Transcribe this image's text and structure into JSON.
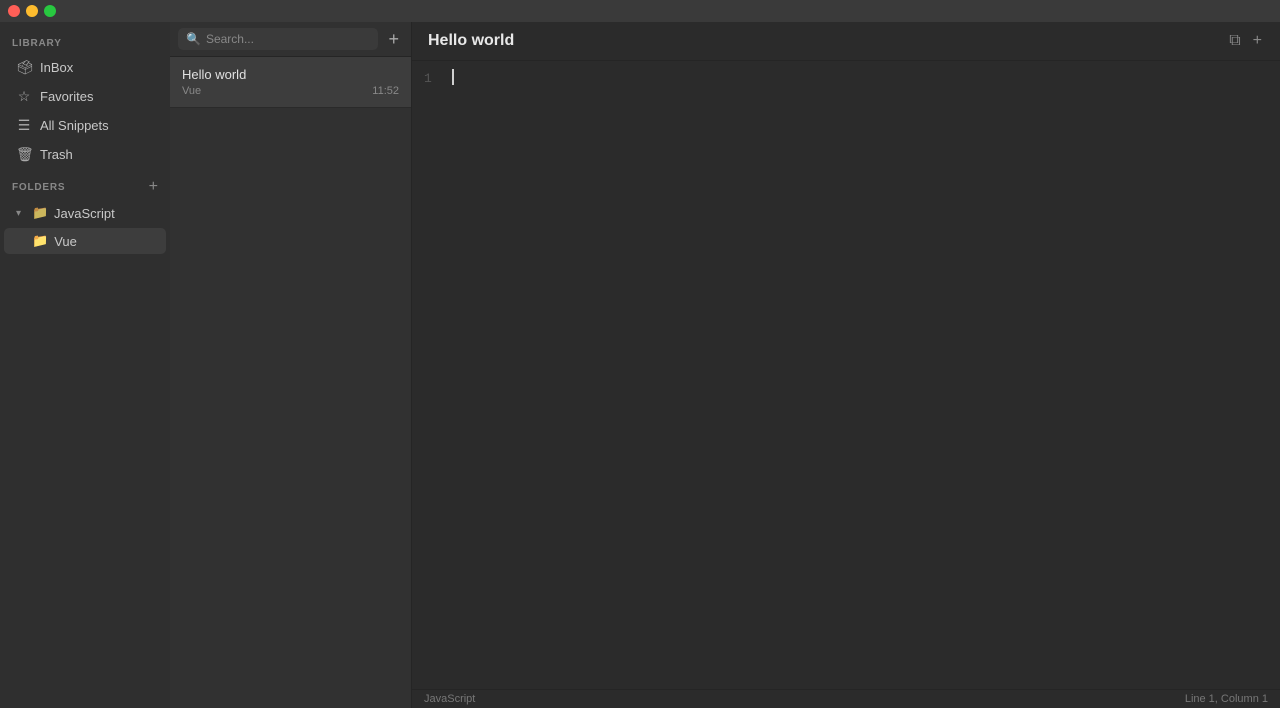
{
  "titlebar": {
    "lights": [
      "close",
      "minimize",
      "maximize"
    ]
  },
  "sidebar": {
    "library_label": "LIBRARY",
    "items": [
      {
        "id": "inbox",
        "label": "InBox",
        "icon": "🗳"
      },
      {
        "id": "favorites",
        "label": "Favorites",
        "icon": "☆"
      },
      {
        "id": "all-snippets",
        "label": "All Snippets",
        "icon": "☰"
      },
      {
        "id": "trash",
        "label": "Trash",
        "icon": "🗑"
      }
    ],
    "folders_label": "FOLDERS",
    "add_folder_label": "+",
    "folders": [
      {
        "id": "javascript",
        "label": "JavaScript",
        "expanded": true,
        "subfolders": [
          {
            "id": "vue",
            "label": "Vue",
            "active": true
          }
        ]
      }
    ]
  },
  "snippet_list": {
    "search_placeholder": "Search...",
    "add_label": "+",
    "snippets": [
      {
        "id": "hello-world",
        "title": "Hello world",
        "folder": "Vue",
        "time": "11:52",
        "active": true
      }
    ]
  },
  "editor": {
    "title": "Hello world",
    "toolbar": {
      "copy_icon": "⧉",
      "plus_icon": "+"
    },
    "line_numbers": [
      "1"
    ],
    "content": "",
    "footer": {
      "language": "JavaScript",
      "position": "Line 1, Column 1"
    }
  }
}
